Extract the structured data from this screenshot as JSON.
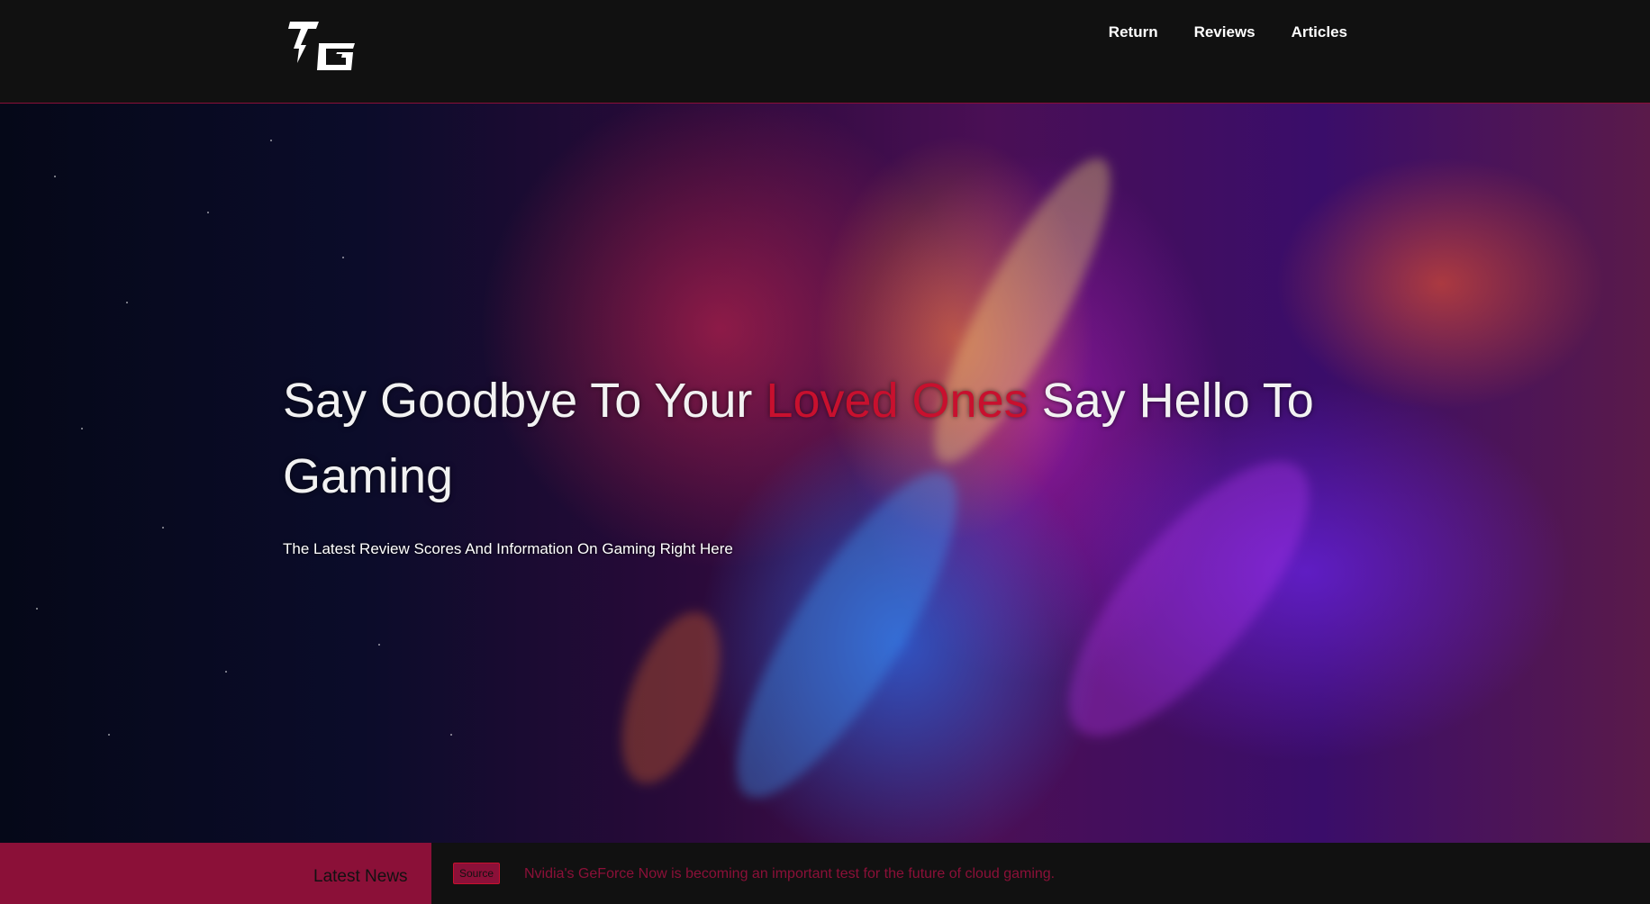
{
  "header": {
    "logo_text": "TG",
    "nav": [
      {
        "label": "Return"
      },
      {
        "label": "Reviews"
      },
      {
        "label": "Articles"
      }
    ]
  },
  "hero": {
    "title_before": "Say Goodbye To Your ",
    "title_accent": "Loved Ones",
    "title_after": " Say Hello To Gaming",
    "subtitle": "The Latest Review Scores And Information On Gaming Right Here"
  },
  "news": {
    "label": "Latest News",
    "source_label": "Source",
    "headline": "Nvidia's GeForce Now is becoming an important test for the future of cloud gaming."
  },
  "colors": {
    "background": "#111111",
    "accent": "#c8102e",
    "brand_crimson": "#8b1038",
    "text": "#ffffff"
  },
  "icons": {
    "logo": "tg-logo-icon"
  }
}
